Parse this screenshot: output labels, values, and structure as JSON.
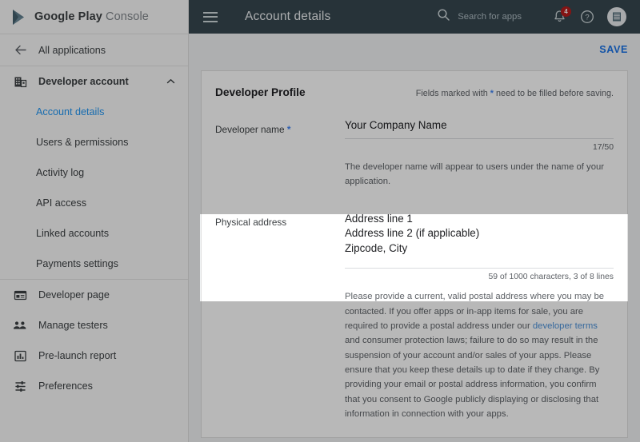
{
  "brand": {
    "name_bold": "Google Play",
    "name_light": "Console",
    "logo_icon": "google-play-logo"
  },
  "sidebar": {
    "back_item": {
      "label": "All applications",
      "icon": "arrow-left-icon"
    },
    "group": {
      "label": "Developer account",
      "icon": "business-building-icon",
      "chevron": "chevron-up-icon"
    },
    "sub_items": [
      {
        "label": "Account details",
        "active": true
      },
      {
        "label": "Users & permissions",
        "active": false
      },
      {
        "label": "Activity log",
        "active": false
      },
      {
        "label": "API access",
        "active": false
      },
      {
        "label": "Linked accounts",
        "active": false
      },
      {
        "label": "Payments settings",
        "active": false
      }
    ],
    "items": [
      {
        "label": "Developer page",
        "icon": "web-page-icon"
      },
      {
        "label": "Manage testers",
        "icon": "people-group-icon"
      },
      {
        "label": "Pre-launch report",
        "icon": "bar-chart-icon"
      },
      {
        "label": "Preferences",
        "icon": "sliders-icon"
      }
    ],
    "active_color": "#2196f3"
  },
  "header": {
    "menu_icon": "hamburger-menu-icon",
    "title": "Account details",
    "search": {
      "icon": "search-icon",
      "placeholder": "Search for apps"
    },
    "notifications": {
      "icon": "bell-icon",
      "badge_count": "4",
      "badge_color": "#b71c1c"
    },
    "help": {
      "icon": "help-circle-icon"
    },
    "account": {
      "icon": "account-avatar-icon"
    },
    "background_color": "#37474f"
  },
  "toolbar": {
    "save_label": "SAVE",
    "save_color": "#1a73e8"
  },
  "card": {
    "title": "Developer Profile",
    "required_note_before": "Fields marked with",
    "required_note_asterisk": "*",
    "required_note_after": "need to be filled before saving.",
    "developer_name": {
      "label": "Developer name",
      "required_marker": "*",
      "value": "Your Company Name",
      "counter": "17/50",
      "helper": "The developer name will appear to users under the name of your application."
    },
    "physical_address": {
      "label": "Physical address",
      "value_line_1": "Address line 1",
      "value_line_2": "Address line 2 (if applicable)",
      "value_line_3": "Zipcode, City",
      "counter": "59 of 1000 characters, 3 of 8 lines",
      "helper_part_1": "Please provide a current, valid postal address where you may be contacted. If you offer apps or in-app items for sale, you are required to provide a postal address under our ",
      "helper_link": "developer terms",
      "helper_part_2": " and consumer protection laws; failure to do so may result in the suspension of your account and/or sales of your apps. Please ensure that you keep these details up to date if they change. By providing your email or postal address information, you confirm that you consent to Google publicly displaying or disclosing that information in connection with your apps."
    }
  }
}
